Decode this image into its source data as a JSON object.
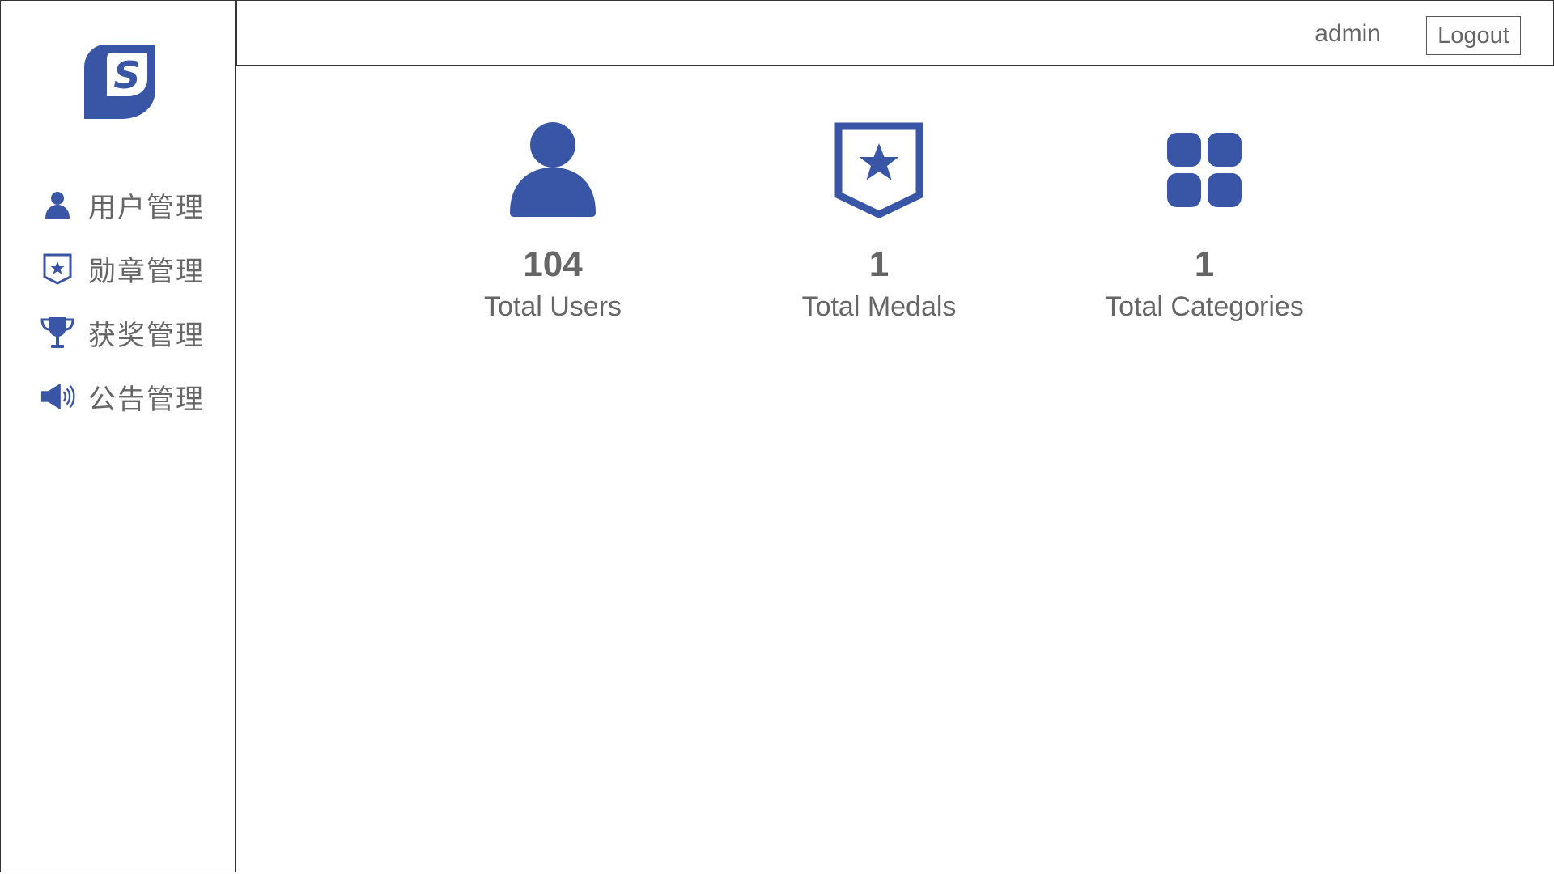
{
  "brand": {
    "color": "#3955a6",
    "logo_icon": "s-logo-icon"
  },
  "sidebar": {
    "items": [
      {
        "label": "用户管理",
        "icon": "user-icon"
      },
      {
        "label": "勋章管理",
        "icon": "medal-shield-icon"
      },
      {
        "label": "获奖管理",
        "icon": "trophy-icon"
      },
      {
        "label": "公告管理",
        "icon": "megaphone-icon"
      }
    ]
  },
  "header": {
    "username": "admin",
    "logout_label": "Logout"
  },
  "stats": [
    {
      "value": "104",
      "label": "Total Users",
      "icon": "user-icon"
    },
    {
      "value": "1",
      "label": "Total Medals",
      "icon": "medal-shield-icon"
    },
    {
      "value": "1",
      "label": "Total Categories",
      "icon": "categories-grid-icon"
    }
  ]
}
